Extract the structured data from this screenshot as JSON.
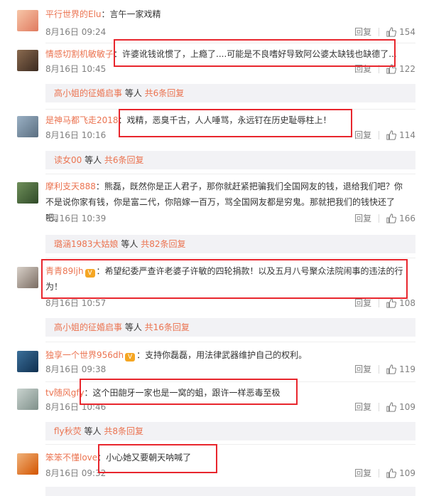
{
  "comments": [
    {
      "user": "平行世界的Elu",
      "text": "：言午一家戏精",
      "time": "8月16日 09:24",
      "reply": "回复",
      "likes": "154"
    },
    {
      "user": "情感切割机敏敏子",
      "text": "：许婆讹钱讹惯了，上瘾了....可能是不良嗜好导致阿公婆太缺钱也缺德了...",
      "time": "8月16日 10:45",
      "reply": "回复",
      "likes": "122"
    },
    {
      "user": "是神马都飞走2018",
      "text": "：戏精，恶臭千古，人人唾骂，永远钉在历史耻辱柱上！",
      "time": "8月16日 10:16",
      "reply": "回复",
      "likes": "114"
    },
    {
      "user": "摩利支天888",
      "text": "：熊磊，既然你是正人君子，那你就赶紧把骗我们全国网友的钱，退给我们吧？你不是说你家有钱，你是富二代，你陪嫁一百万，骂全国网友都是穷鬼。那就把我们的钱快还了吧。",
      "time": "8月16日 10:39",
      "reply": "回复",
      "likes": "166"
    },
    {
      "user": "青青89ljh",
      "text": "：希望纪委严查许老婆子许敏的四轮捐款！以及五月八号聚众法院闹事的违法的行为！",
      "time": "8月16日 10:57",
      "reply": "回复",
      "likes": "108"
    },
    {
      "user": "独享一个世界956dh",
      "text": "：支持你磊磊，用法律武器维护自己的权利。",
      "time": "8月16日 09:38",
      "reply": "回复",
      "likes": "119"
    },
    {
      "user": "tv随风gfy",
      "text": "：这个田龅牙一家也是一窝的蛆，跟许一样恶毒至极",
      "time": "8月16日 10:46",
      "reply": "回复",
      "likes": "109"
    },
    {
      "user": "笨笨不懂love",
      "text": "：小心她又要朝天呐喊了",
      "time": "8月16日 09:32",
      "reply": "回复",
      "likes": "109"
    }
  ],
  "subreplies": [
    {
      "user": "高小姐的征婚启事",
      "mid": " 等人 ",
      "count": "共6条回复"
    },
    {
      "user": "读女00",
      "mid": " 等人 ",
      "count": "共6条回复"
    },
    {
      "user": "璐涵1983大姑娘",
      "mid": " 等人 ",
      "count": "共82条回复"
    },
    {
      "user": "高小姐的征婚启事",
      "mid": " 等人 ",
      "count": "共16条回复"
    },
    {
      "user": "fly秋荧",
      "mid": " 等人 ",
      "count": "共8条回复"
    }
  ],
  "colors": {
    "username": "#eb7350",
    "highlight_box": "#e8262d",
    "meta": "#808080"
  }
}
